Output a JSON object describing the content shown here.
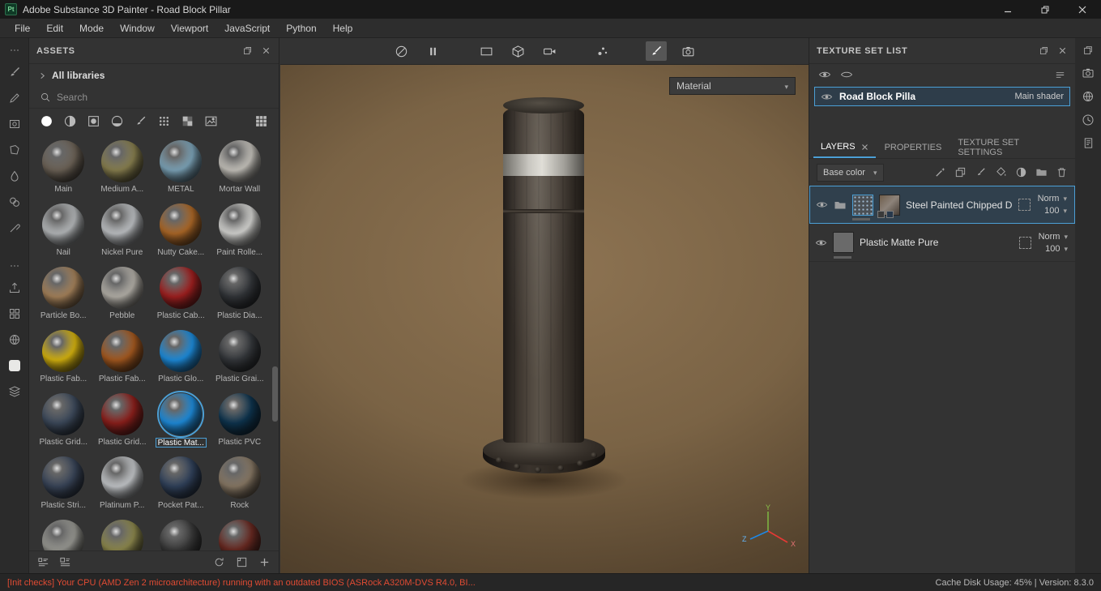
{
  "titlebar": {
    "app_badge": "Pt",
    "title": "Adobe Substance 3D Painter - Road Block Pillar"
  },
  "menubar": {
    "items": [
      "File",
      "Edit",
      "Mode",
      "Window",
      "Viewport",
      "JavaScript",
      "Python",
      "Help"
    ]
  },
  "left_toolbar": {
    "tools": [
      "paint-tool",
      "eraser-tool",
      "projection-tool",
      "polygon-fill-tool",
      "smudge-tool",
      "clone-tool",
      "material-picker-tool",
      "export-textures",
      "resources",
      "display-settings",
      "white-swatch",
      "shelf-stack"
    ]
  },
  "assets": {
    "title": "ASSETS",
    "library": "All libraries",
    "search_placeholder": "Search",
    "filter_icons": [
      "materials",
      "smart-materials",
      "smart-masks",
      "filters",
      "brushes",
      "alphas",
      "textures",
      "environments",
      "thumbnails-view"
    ],
    "materials": [
      {
        "name": "Main",
        "color": "#6e6458"
      },
      {
        "name": "Medium A...",
        "color": "#8a8150"
      },
      {
        "name": "METAL",
        "color": "#7fa7bc"
      },
      {
        "name": "Mortar Wall",
        "color": "#c9c6bf"
      },
      {
        "name": "Nail",
        "color": "#b9bcbe"
      },
      {
        "name": "Nickel Pure",
        "color": "#c2c5c8"
      },
      {
        "name": "Nutty Cake...",
        "color": "#b06a28"
      },
      {
        "name": "Paint Rolle...",
        "color": "#d9d9d6"
      },
      {
        "name": "Particle Bo...",
        "color": "#a8845c"
      },
      {
        "name": "Pebble",
        "color": "#b7b3ab"
      },
      {
        "name": "Plastic Cab...",
        "color": "#a32020"
      },
      {
        "name": "Plastic Dia...",
        "color": "#33363a"
      },
      {
        "name": "Plastic Fab...",
        "color": "#d9b60f"
      },
      {
        "name": "Plastic Fab...",
        "color": "#a85b20"
      },
      {
        "name": "Plastic Glo...",
        "color": "#1e8fe0"
      },
      {
        "name": "Plastic Grai...",
        "color": "#35383c"
      },
      {
        "name": "Plastic Grid...",
        "color": "#3d4a5c"
      },
      {
        "name": "Plastic Grid...",
        "color": "#8f201c"
      },
      {
        "name": "Plastic Mat...",
        "color": "#1f8fe0",
        "selected": true
      },
      {
        "name": "Plastic PVC",
        "color": "#0e3550"
      },
      {
        "name": "Plastic Stri...",
        "color": "#3a465a"
      },
      {
        "name": "Platinum P...",
        "color": "#c7cacd"
      },
      {
        "name": "Pocket Pat...",
        "color": "#31425c"
      },
      {
        "name": "Rock",
        "color": "#8a7a66"
      },
      {
        "name": "",
        "color": "#9a9a94"
      },
      {
        "name": "",
        "color": "#8f8a4e"
      },
      {
        "name": "",
        "color": "#3a3a3a"
      },
      {
        "name": "",
        "color": "#6b2a22"
      }
    ]
  },
  "viewport": {
    "toolbar_icons": [
      "symmetry",
      "pause-engine",
      "view-2d",
      "view-3d",
      "camera",
      "particles",
      "brush",
      "screenshot"
    ],
    "active_tool": "brush",
    "shading_mode": "Material",
    "axis_labels": {
      "x": "X",
      "y": "Y",
      "z": "Z"
    }
  },
  "texture_set_list": {
    "title": "TEXTURE SET LIST",
    "sets": [
      {
        "name": "Road Block Pilla",
        "shader_label": "Main shader",
        "selected": true
      }
    ]
  },
  "layers_panel": {
    "tabs": [
      {
        "label": "LAYERS",
        "active": true
      },
      {
        "label": "PROPERTIES"
      },
      {
        "label": "TEXTURE SET SETTINGS"
      }
    ],
    "channel_filter": "Base color",
    "toolbar_icons": [
      "add-effect-wand",
      "add-smart-material",
      "add-paint-layer",
      "add-fill-layer",
      "add-mask",
      "add-group-folder",
      "delete-layer"
    ],
    "layers": [
      {
        "name": "Steel Painted Chipped Dirty",
        "blend": "Norm",
        "opacity": "100",
        "selected": true
      },
      {
        "name": "Plastic Matte Pure",
        "blend": "Norm",
        "opacity": "100",
        "selected": false
      }
    ]
  },
  "right_toolbar": {
    "icons": [
      "undock-panel",
      "camera",
      "environment-display",
      "history",
      "log"
    ]
  },
  "statusbar": {
    "message": "[Init checks] Your CPU (AMD Zen 2 microarchitecture) running with an outdated BIOS (ASRock A320M-DVS R4.0, BI...",
    "cache_info": "Cache Disk Usage:   45% | Version: 8.3.0"
  },
  "colors": {
    "accent": "#4b9fd5",
    "status_message": "#e04b33"
  }
}
